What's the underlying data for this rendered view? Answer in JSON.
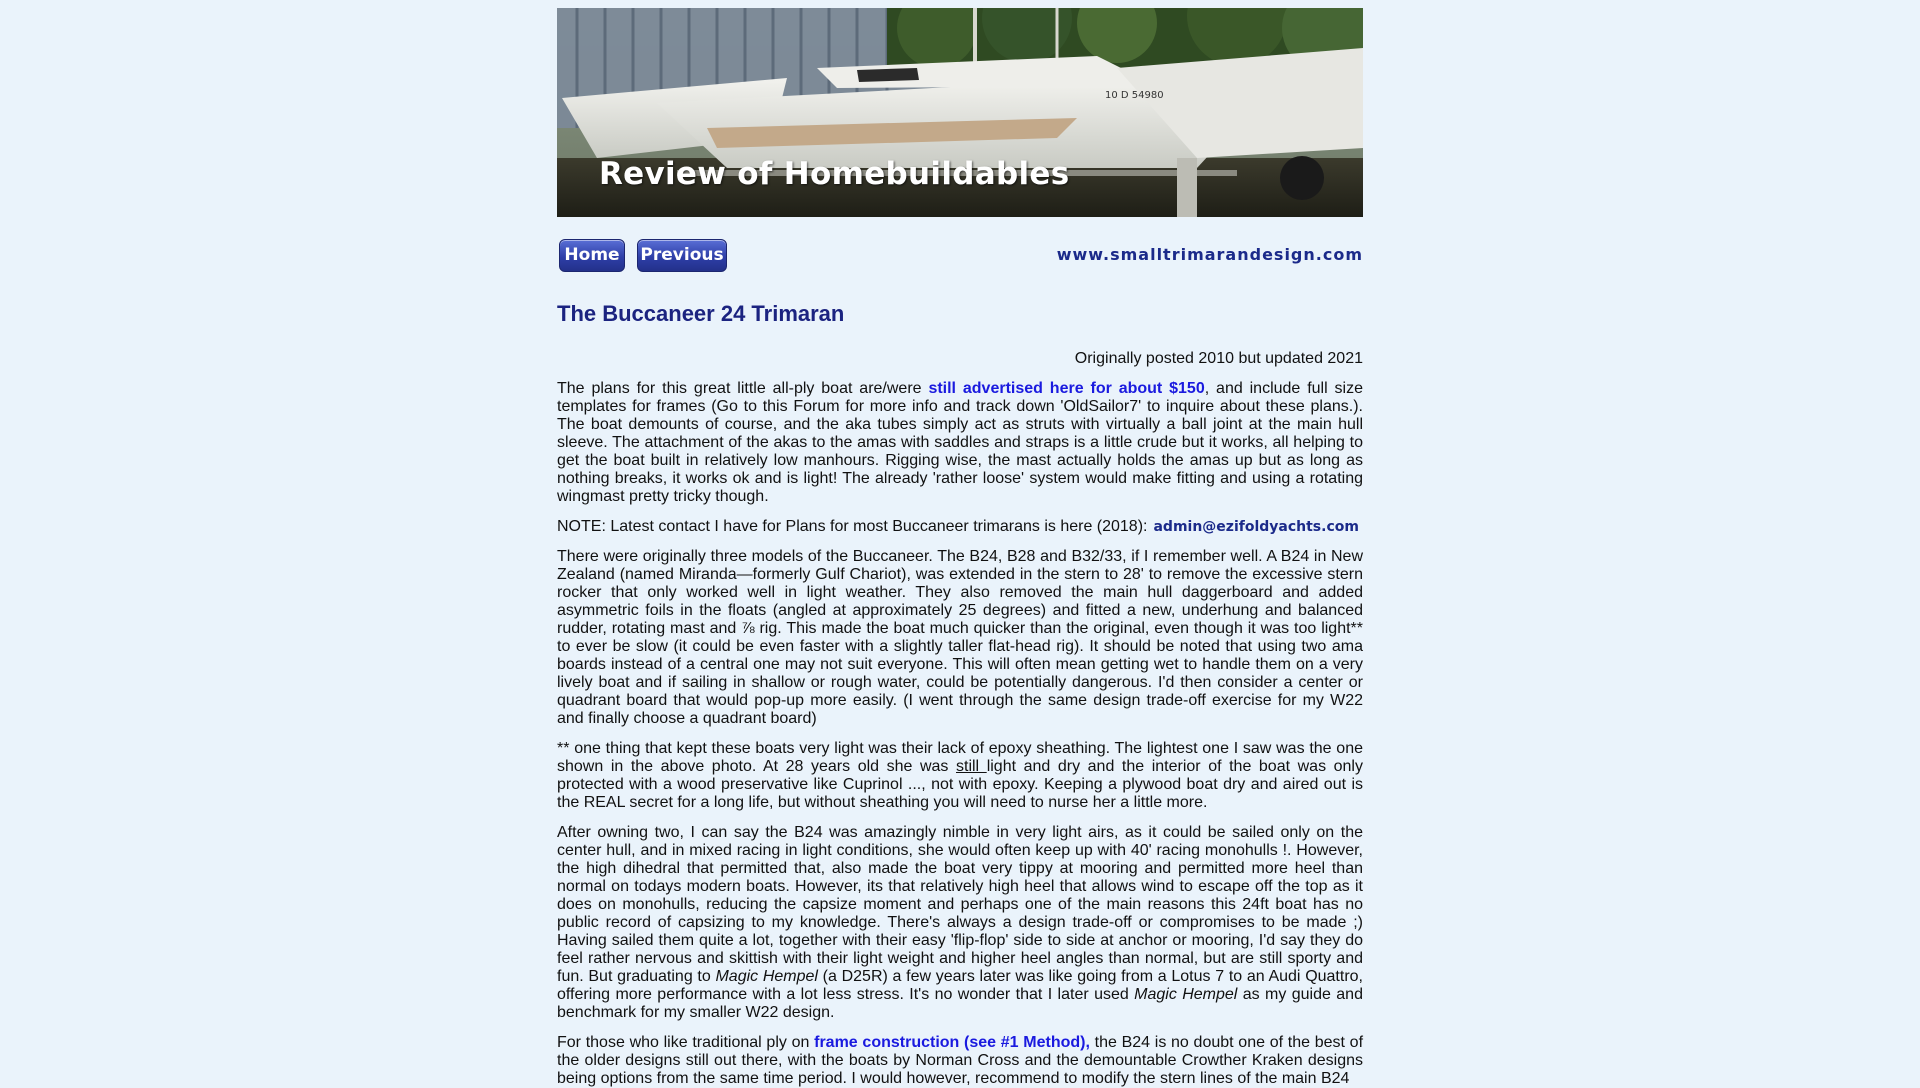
{
  "header": {
    "banner_title": "Review of Homebuildables",
    "boat_registration": "10 D 54980"
  },
  "nav": {
    "home_label": "Home",
    "previous_label": "Previous",
    "site_url": "www.smalltrimarandesign.com"
  },
  "article": {
    "title": "The Buccaneer 24 Trimaran",
    "posted": "Originally posted 2010 but updated 2021",
    "p1": {
      "before": "The plans for this great little all-ply boat are/were ",
      "link": "still advertised here for about $150",
      "after": ", and include full size templates for frames (Go to this Forum for more info and track down 'OldSailor7' to inquire about these plans.).  The boat demounts of course, and the aka tubes simply act as struts with virtually a ball joint at the main hull sleeve.  The attachment of the akas to the amas with saddles and straps is a little crude but it works, all helping to get the boat built in relatively low manhours.  Rigging wise, the mast actually holds the amas up but as long as nothing breaks, it works ok and is light!   The already 'rather loose' system would make fitting and using a rotating wingmast pretty tricky though."
    },
    "note": {
      "text": "NOTE:  Latest contact I have for Plans for most Buccaneer trimarans is here (2018):",
      "email": "admin@ezifoldyachts.com"
    },
    "p2": "There were originally three models of the Buccaneer. The B24, B28 and B32/33, if I remember well. A B24 in New Zealand (named Miranda—formerly Gulf Chariot), was extended in the stern to 28' to remove the excessive stern rocker that only worked well in light weather. They also removed the main hull daggerboard and added asymmetric foils in the floats (angled at approximately 25 degrees) and fitted a new, underhung and balanced rudder, rotating mast and ⅞ rig. This made the boat much quicker than the original, even though it was too light** to ever be slow (it could be even faster with a slightly taller flat-head rig).  It should be noted that using two ama boards instead of a central one may not suit everyone.   This will often mean getting wet to handle them on a very lively boat and if sailing in shallow or rough water, could be potentially dangerous.   I'd then consider a center or quadrant board that would pop-up more easily.  (I went through the same design trade-off exercise for my W22 and finally choose a quadrant board)",
    "p3": {
      "before": "** one thing that kept these boats very light was their lack of epoxy sheathing.  The lightest one I saw was the one shown in the above photo.  At 28 years old she was ",
      "underlined": "still ",
      "after": "light and dry and the interior of the boat was only protected with a wood preservative like Cuprinol ..., not with epoxy.     Keeping a plywood boat dry and aired out is the REAL secret for a long life, but without sheathing you will need to nurse her a little more."
    },
    "p4": {
      "part1": "After owning two, I can say the B24 was amazingly nimble in very light airs, as it could be sailed only on the center hull, and in mixed racing in light conditions, she would often keep up with 40' racing monohulls !.   However, the high dihedral that permitted that, also made the boat very tippy at mooring and permitted more heel than normal on todays modern boats.   However, its that relatively high heel that allows wind to escape off the top as it does on monohulls, reducing the capsize moment and perhaps one of the main reasons this 24ft boat has no public record of capsizing to my knowledge.  There's always a design trade-off or compromises to be made ;)     Having sailed them quite a lot, together with their easy 'flip-flop' side to side at anchor or mooring, I'd say they do feel rather nervous and skittish with their light weight and higher heel angles than normal, but are still sporty and fun.   But graduating to ",
      "italic1": "Magic Hempel",
      "part2": " (a D25R) a few years later was like going from a Lotus 7 to an Audi Quattro, offering more performance with a lot less stress.    It's no wonder that I later used ",
      "italic2": "Magic Hempel",
      "part3": " as my guide and benchmark for my smaller W22 design."
    },
    "p5": {
      "before": "For those who like traditional ply on ",
      "link": "frame construction (see #1 Method),",
      "after": " the B24 is no doubt one of the best of the older designs still out there, with the boats by Norman Cross and the demountable Crowther Kraken designs being options from the same time period. I would however, recommend to modify the stern lines of the main B24"
    }
  },
  "colors": {
    "background": "#eaf3fb",
    "title": "#1b2380",
    "link": "#1a1adf",
    "button": "#2e3fa8"
  }
}
